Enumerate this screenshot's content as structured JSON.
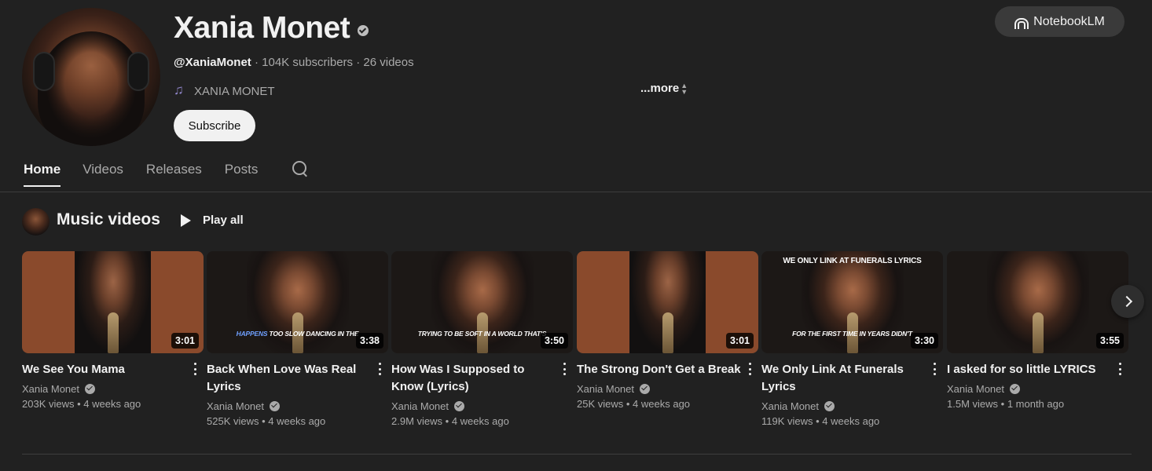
{
  "channel": {
    "name": "Xania Monet",
    "handle": "@XaniaMonet",
    "subscribers": "104K subscribers",
    "videos_count": "26 videos",
    "artist_label": "XANIA MONET",
    "more_label": "...more",
    "subscribe_label": "Subscribe"
  },
  "header": {
    "notebook_label": "NotebookLM"
  },
  "tabs": [
    {
      "label": "Home",
      "active": true
    },
    {
      "label": "Videos",
      "active": false
    },
    {
      "label": "Releases",
      "active": false
    },
    {
      "label": "Posts",
      "active": false
    }
  ],
  "section": {
    "title": "Music videos",
    "play_all_label": "Play all"
  },
  "videos": [
    {
      "title": "We See You Mama",
      "channel": "Xania Monet",
      "views": "203K views",
      "age": "4 weeks ago",
      "duration": "3:01",
      "overlay_top": "",
      "overlay_highlight": "",
      "overlay_bottom": "",
      "style": "brown"
    },
    {
      "title": "Back When Love Was Real Lyrics",
      "channel": "Xania Monet",
      "views": "525K views",
      "age": "4 weeks ago",
      "duration": "3:38",
      "overlay_top": "",
      "overlay_highlight": "HAPPENS",
      "overlay_bottom": " TOO SLOW DANCING IN THE",
      "style": "dark"
    },
    {
      "title": "How Was I Supposed to Know (Lyrics)",
      "channel": "Xania Monet",
      "views": "2.9M views",
      "age": "4 weeks ago",
      "duration": "3:50",
      "overlay_top": "",
      "overlay_highlight": "",
      "overlay_bottom": "TRYING TO BE SOFT IN A WORLD THAT'S",
      "style": "dark"
    },
    {
      "title": "The Strong Don't Get a Break",
      "channel": "Xania Monet",
      "views": "25K views",
      "age": "4 weeks ago",
      "duration": "3:01",
      "overlay_top": "",
      "overlay_highlight": "",
      "overlay_bottom": "",
      "style": "brown"
    },
    {
      "title": "We Only Link At Funerals Lyrics",
      "channel": "Xania Monet",
      "views": "119K views",
      "age": "4 weeks ago",
      "duration": "3:30",
      "overlay_top": "WE ONLY LINK AT FUNERALS LYRICS",
      "overlay_highlight": "",
      "overlay_bottom": "FOR THE FIRST TIME IN YEARS DIDN'T",
      "style": "dark"
    },
    {
      "title": "I asked for so little LYRICS",
      "channel": "Xania Monet",
      "views": "1.5M views",
      "age": "1 month ago",
      "duration": "3:55",
      "overlay_top": "",
      "overlay_highlight": "",
      "overlay_bottom": "",
      "style": "dark"
    }
  ],
  "icons": {
    "verified": "verified-badge-icon",
    "music": "music-note-icon",
    "search": "search-icon",
    "play": "play-icon",
    "next": "chevron-right-icon",
    "menu": "more-vert-icon"
  },
  "colors": {
    "background": "#212121",
    "text_primary": "#f1f1f1",
    "text_secondary": "#aaaaaa",
    "thumb_brown": "#8a4a2c"
  }
}
